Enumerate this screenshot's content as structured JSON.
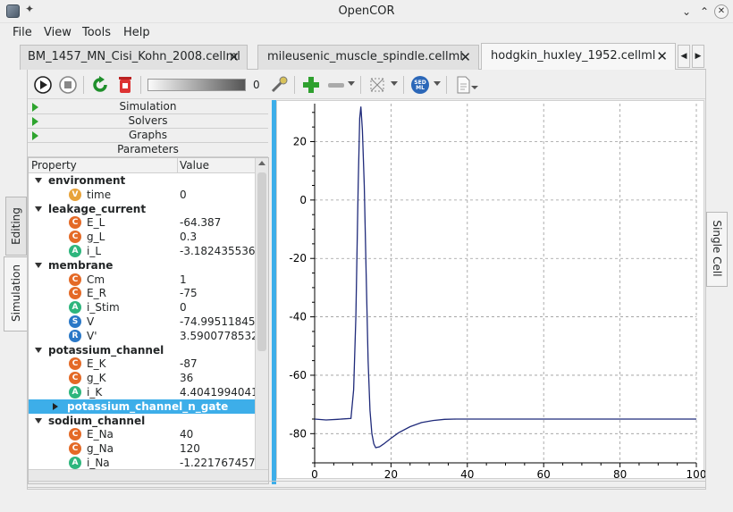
{
  "window": {
    "title": "OpenCOR"
  },
  "menu": [
    "File",
    "View",
    "Tools",
    "Help"
  ],
  "tabs": [
    {
      "label": "BM_1457_MN_Cisi_Kohn_2008.cellml",
      "active": false
    },
    {
      "label": "mileusenic_muscle_spindle.cellml",
      "active": false
    },
    {
      "label": "hodgkin_huxley_1952.cellml",
      "active": true
    }
  ],
  "toolbar": {
    "delay_value": "0"
  },
  "side_tabs": {
    "left": [
      "Editing",
      "Simulation"
    ],
    "right": "Single Cell"
  },
  "sections": [
    "Simulation",
    "Solvers",
    "Graphs",
    "Parameters"
  ],
  "table": {
    "col_property": "Property",
    "col_value": "Value",
    "rows": [
      {
        "kind": "group",
        "name": "environment"
      },
      {
        "kind": "param",
        "badge": "V",
        "name": "time",
        "value": "0"
      },
      {
        "kind": "group",
        "name": "leakage_current"
      },
      {
        "kind": "param",
        "badge": "C",
        "name": "E_L",
        "value": "-64.387"
      },
      {
        "kind": "param",
        "badge": "C",
        "name": "g_L",
        "value": "0.3"
      },
      {
        "kind": "param",
        "badge": "A",
        "name": "i_L",
        "value": "-3.182435536"
      },
      {
        "kind": "group",
        "name": "membrane"
      },
      {
        "kind": "param",
        "badge": "C",
        "name": "Cm",
        "value": "1"
      },
      {
        "kind": "param",
        "badge": "C",
        "name": "E_R",
        "value": "-75"
      },
      {
        "kind": "param",
        "badge": "A",
        "name": "i_Stim",
        "value": "0"
      },
      {
        "kind": "param",
        "badge": "S",
        "name": "V",
        "value": "-74.99511845"
      },
      {
        "kind": "param",
        "badge": "R",
        "name": "V'",
        "value": "3.5900778532"
      },
      {
        "kind": "group",
        "name": "potassium_channel"
      },
      {
        "kind": "param",
        "badge": "C",
        "name": "E_K",
        "value": "-87"
      },
      {
        "kind": "param",
        "badge": "C",
        "name": "g_K",
        "value": "36"
      },
      {
        "kind": "param",
        "badge": "A",
        "name": "i_K",
        "value": "4.4041994041"
      },
      {
        "kind": "subgroup",
        "name": "potassium_channel_n_gate",
        "selected": true
      },
      {
        "kind": "group",
        "name": "sodium_channel"
      },
      {
        "kind": "param",
        "badge": "C",
        "name": "E_Na",
        "value": "40"
      },
      {
        "kind": "param",
        "badge": "C",
        "name": "g_Na",
        "value": "120"
      },
      {
        "kind": "param",
        "badge": "A",
        "name": "i_Na",
        "value": "-1.221767457"
      }
    ]
  },
  "badge_colors": {
    "V": "#e8a33a",
    "C": "#e46a27",
    "A": "#2eb67d",
    "S": "#2a78c7",
    "R": "#2a78c7"
  },
  "chart_data": {
    "type": "line",
    "title": "",
    "xlabel": "",
    "ylabel": "",
    "xlim": [
      0,
      100
    ],
    "ylim": [
      -90,
      33
    ],
    "xticks": [
      0,
      20,
      40,
      60,
      80,
      100
    ],
    "yticks": [
      -80,
      -60,
      -40,
      -20,
      0,
      20
    ],
    "grid": true,
    "line_color": "#1f2a7a",
    "series": [
      {
        "x": [
          0,
          3,
          6,
          9.5,
          10.2,
          10.8,
          11.4,
          11.8,
          12.1,
          12.5,
          13,
          13.5,
          14,
          14.5,
          15,
          15.5,
          16,
          17,
          18,
          20,
          22,
          25,
          28,
          31,
          34,
          37,
          40,
          50,
          60,
          70,
          80,
          90,
          100
        ],
        "y": [
          -75,
          -75.3,
          -75.1,
          -74.8,
          -65,
          -40,
          5,
          28,
          32,
          24,
          5,
          -25,
          -55,
          -72,
          -80,
          -83.5,
          -84.8,
          -84.5,
          -83.6,
          -81.6,
          -79.7,
          -77.6,
          -76.2,
          -75.5,
          -75.1,
          -75,
          -75,
          -75,
          -75,
          -75,
          -75,
          -75,
          -75
        ]
      }
    ]
  }
}
